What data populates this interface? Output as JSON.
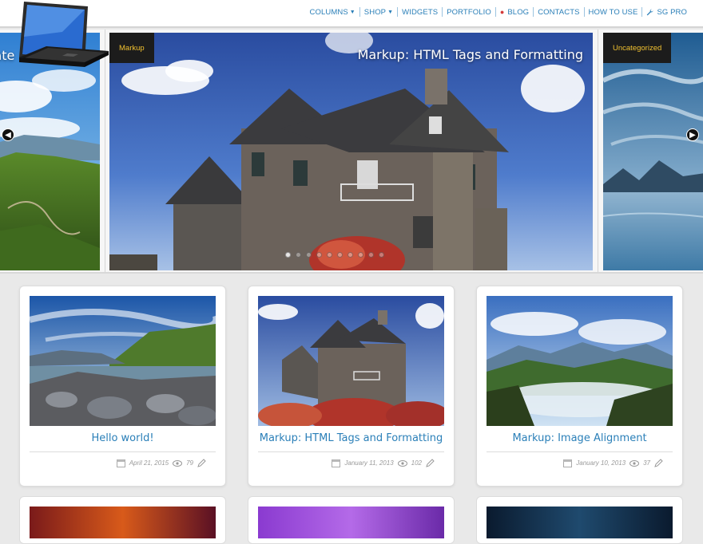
{
  "nav": {
    "items": [
      {
        "label": "COLUMNS",
        "caret": true
      },
      {
        "label": "SHOP",
        "caret": true
      },
      {
        "label": "WIDGETS",
        "caret": false
      },
      {
        "label": "PORTFOLIO",
        "caret": false
      },
      {
        "label": "BLOG",
        "caret": false
      },
      {
        "label": "CONTACTS",
        "caret": false
      },
      {
        "label": "HOW TO USE",
        "caret": false
      },
      {
        "label": "SG PRO",
        "caret": false
      }
    ]
  },
  "slider": {
    "left_title": "late",
    "main_category": "Markup",
    "main_title": "Markup: HTML Tags and Formatting",
    "right_category": "Uncategorized",
    "dot_count": 10,
    "active_dot": 0
  },
  "cards": [
    {
      "title": "Hello world!",
      "date": "April 21, 2015",
      "views": "79"
    },
    {
      "title": "Markup: HTML Tags and Formatting",
      "date": "January 11, 2013",
      "views": "102"
    },
    {
      "title": "Markup: Image Alignment",
      "date": "January 10, 2013",
      "views": "37"
    }
  ],
  "icons": {
    "calendar": "calendar-icon",
    "views": "eye-icon",
    "edit": "pencil-icon",
    "wrench": "wrench-icon"
  },
  "colors": {
    "link": "#2a7fb8",
    "tag_bg": "#1c1c1c",
    "tag_text": "#f0c030",
    "page_bg": "#e9e9e9"
  }
}
